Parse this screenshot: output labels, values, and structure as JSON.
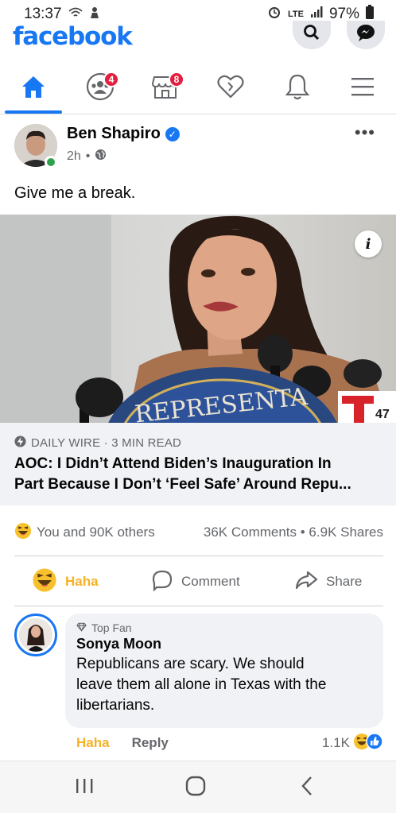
{
  "status_bar": {
    "time": "13:37",
    "network": "LTE",
    "battery": "97%"
  },
  "app": {
    "brand": "facebook",
    "brand_color": "#1877f2"
  },
  "nav": {
    "tabs": [
      {
        "name": "home",
        "icon": "home-icon",
        "active": true
      },
      {
        "name": "groups",
        "icon": "groups-icon",
        "badge": "4"
      },
      {
        "name": "marketplace",
        "icon": "marketplace-icon",
        "badge": "8"
      },
      {
        "name": "dating",
        "icon": "heart-icon"
      },
      {
        "name": "notifications",
        "icon": "bell-icon"
      },
      {
        "name": "menu",
        "icon": "hamburger-icon"
      }
    ]
  },
  "post": {
    "author": "Ben Shapiro",
    "time": "2h",
    "text": "Give me a break.",
    "link": {
      "source": "DAILY WIRE · 3 MIN READ",
      "headline_line1": "AOC: I Didn’t Attend Biden’s Inauguration In",
      "headline_line2": "Part Because I Don’t ‘Feel Safe’ Around Repu...",
      "podium_text": "REPRESENTA",
      "mic_label": "47"
    },
    "reactions_text": "You and 90K others",
    "stats_text": "36K Comments • 6.9K Shares",
    "actions": {
      "haha": "Haha",
      "comment": "Comment",
      "share": "Share"
    }
  },
  "comment": {
    "badge": "Top Fan",
    "name": "Sonya Moon",
    "line1": "Republicans are scary. We should",
    "line2": "leave them all alone in Texas with the",
    "line3": "libertarians.",
    "haha": "Haha",
    "reply": "Reply",
    "reaction_count": "1.1K"
  }
}
